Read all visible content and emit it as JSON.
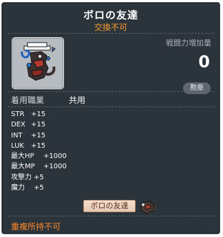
{
  "item": {
    "name": "ボロの友達",
    "trade_status": "交換不可",
    "combat_power_label": "戦闘力増加量",
    "combat_power_value": "0",
    "medal_label": "勲章",
    "equip_job_label": "着用職業",
    "equip_job_value": "共用",
    "stats": [
      {
        "name": "STR",
        "value": "+15"
      },
      {
        "name": "DEX",
        "value": "+15"
      },
      {
        "name": "INT",
        "value": "+15"
      },
      {
        "name": "LUK",
        "value": "+15"
      },
      {
        "name": "最大HP",
        "value": "+1000"
      },
      {
        "name": "最大MP",
        "value": "+1000"
      },
      {
        "name": "攻撃力",
        "value": "+5"
      },
      {
        "name": "魔力",
        "value": "+5"
      }
    ],
    "tag_label": "ボロの友達",
    "footer_note": "重複所持不可"
  },
  "colors": {
    "panel_bg": "#2b333b",
    "accent_orange": "#ff9d2e",
    "footer_orange": "#ff8a2a"
  },
  "icons": {
    "item_icon": "bolo-friend-icon",
    "tag_icon": "bolo-mascot-icon"
  }
}
